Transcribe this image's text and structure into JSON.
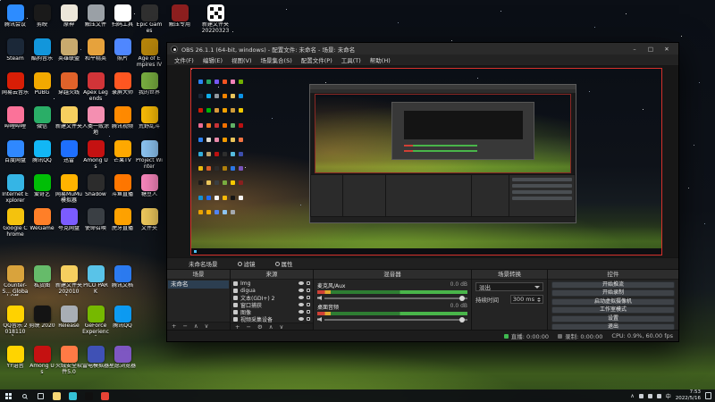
{
  "wallpaper": {
    "sky": "#0b0f16",
    "grass": "#41601f",
    "glow": "#de9239"
  },
  "desktop": {
    "main_icons": [
      {
        "label": "腾讯会议",
        "color": "#2d8cff"
      },
      {
        "label": "Steam",
        "color": "#1b2838"
      },
      {
        "label": "网易云音乐",
        "color": "#d81e06"
      },
      {
        "label": "哔哩哔哩",
        "color": "#fb7299"
      },
      {
        "label": "百度网盘",
        "color": "#2f88ff"
      },
      {
        "label": "Internet Explorer",
        "color": "#35b5e5"
      },
      {
        "label": "Google Chrome",
        "color": "#f4c20d"
      },
      {
        "label": "剪映",
        "color": "#1a1a1a"
      },
      {
        "label": "酷狗音乐",
        "color": "#1296db"
      },
      {
        "label": "PUBG",
        "color": "#f2a900"
      },
      {
        "label": "微信",
        "color": "#2aae67"
      },
      {
        "label": "腾讯QQ",
        "color": "#12b7f5"
      },
      {
        "label": "爱奇艺",
        "color": "#00be06"
      },
      {
        "label": "WeGame",
        "color": "#ff7f28"
      },
      {
        "label": "原神",
        "color": "#ece6d9"
      },
      {
        "label": "英雄联盟",
        "color": "#c8aa6e"
      },
      {
        "label": "穿越火线",
        "color": "#e0622a"
      },
      {
        "label": "新建文件夹",
        "color": "#f6cf5f"
      },
      {
        "label": "迅雷",
        "color": "#1e6fff"
      },
      {
        "label": "网易MuMu模拟器",
        "color": "#ffb300"
      },
      {
        "label": "夸克网盘",
        "color": "#7b5cff"
      },
      {
        "label": "解压文件",
        "color": "#9aa0a6"
      },
      {
        "label": "和平精英",
        "color": "#e6a23c"
      },
      {
        "label": "Apex Legends",
        "color": "#d13438"
      },
      {
        "label": "人类一败涂地",
        "color": "#f48fb1"
      },
      {
        "label": "Among Us",
        "color": "#c51111"
      },
      {
        "label": "Shadow",
        "color": "#2c2c2c"
      },
      {
        "label": "使命召唤",
        "color": "#3a3f44"
      },
      {
        "label": "扫码工具",
        "color": "#ffffff"
      },
      {
        "label": "照片",
        "color": "#4f87ff"
      },
      {
        "label": "录屏大师",
        "color": "#ff5722"
      },
      {
        "label": "腾讯视频",
        "color": "#ff8a00"
      },
      {
        "label": "芒果TV",
        "color": "#ffa900"
      },
      {
        "label": "斗鱼直播",
        "color": "#ff7700"
      },
      {
        "label": "虎牙直播",
        "color": "#ffa200"
      },
      {
        "label": "Epic Games",
        "color": "#2f2f2f"
      },
      {
        "label": "Age of Empires IV",
        "color": "#b8860b"
      },
      {
        "label": "我的世界",
        "color": "#7cb342"
      },
      {
        "label": "荒野乱斗",
        "color": "#ffc107"
      },
      {
        "label": "Project Winter",
        "color": "#90caf9"
      },
      {
        "label": "糖豆人",
        "color": "#ff8ac2"
      },
      {
        "label": "文件夹",
        "color": "#f6cf5f"
      }
    ],
    "bottom_icons": [
      {
        "label": "Counter-S... Global Off...",
        "color": "#d9a33c"
      },
      {
        "label": "私货图",
        "color": "#66bb6a"
      },
      {
        "label": "新建文件夹 2020101...",
        "color": "#f6cf5f"
      },
      {
        "label": "PICO PARK",
        "color": "#59c3e8"
      },
      {
        "label": "腾讯文档",
        "color": "#2c7bf0"
      },
      {
        "label": "QQ音乐 20181101...",
        "color": "#ffd200"
      },
      {
        "label": "剪映 2020",
        "color": "#141414"
      },
      {
        "label": "Release",
        "color": "#a8aeb5"
      },
      {
        "label": "GeForce Experience",
        "color": "#76b900"
      },
      {
        "label": "腾讯QQ",
        "color": "#0d9bf2"
      },
      {
        "label": "YY语音",
        "color": "#ffd400"
      },
      {
        "label": "Among Us",
        "color": "#c51111"
      },
      {
        "label": "火绒安全软件5.0",
        "color": "#ff7a45"
      },
      {
        "label": "雷电模拟器",
        "color": "#3f51b5"
      },
      {
        "label": "星愿浏览器",
        "color": "#7e57c2"
      }
    ],
    "top_icons": [
      {
        "label": "解压专用",
        "color": "#8d1f1f"
      },
      {
        "label": "新建文件夹 20220323",
        "color": "#ffffff",
        "qr": true
      }
    ]
  },
  "obs": {
    "title": "OBS 26.1.1 (64-bit, windows) - 配置文件: 未命名 - 场景: 未命名",
    "menu": [
      "文件(F)",
      "编辑(E)",
      "视图(V)",
      "场景集合(S)",
      "配置文件(P)",
      "工具(T)",
      "帮助(H)"
    ],
    "window_buttons": {
      "min": "–",
      "max": "□",
      "close": "✕"
    },
    "scene_row": {
      "label": "未命名场景",
      "filters": "滤镜",
      "properties": "属性"
    },
    "docks": {
      "scenes": {
        "title": "场景",
        "items": [
          "未命名"
        ],
        "toolbar": [
          "+",
          "−",
          "∧",
          "∨"
        ]
      },
      "sources": {
        "title": "来源",
        "items": [
          {
            "name": "Img"
          },
          {
            "name": "digua"
          },
          {
            "name": "文本(GDI+) 2"
          },
          {
            "name": "窗口捕获"
          },
          {
            "name": "图像"
          },
          {
            "name": "视频采集设备"
          }
        ],
        "toolbar": [
          "+",
          "−",
          "⚙",
          "∧",
          "∨"
        ]
      },
      "mixer": {
        "title": "混音器",
        "channels": [
          {
            "name": "麦克风/Aux",
            "db": "0.0 dB"
          },
          {
            "name": "桌面音频",
            "db": "0.0 dB"
          }
        ]
      },
      "transitions": {
        "title": "场景转换",
        "selected": "淡出",
        "duration_label": "持续时间",
        "duration": "300 ms"
      },
      "controls": {
        "title": "控件",
        "buttons": [
          "开始推流",
          "开始录制",
          "启动虚拟摄像机",
          "工作室模式",
          "设置",
          "退出"
        ]
      }
    },
    "statusbar": {
      "live": "直播: 0:00:00",
      "rec": "录制: 0:00:00",
      "cpu": "CPU: 0.9%, 60.00 fps"
    }
  },
  "taskbar": {
    "apps": [
      {
        "name": "file-explorer",
        "color": "#f8d775"
      },
      {
        "name": "edge",
        "color": "#35c1d6"
      },
      {
        "name": "obs-studio",
        "color": "#101010"
      },
      {
        "name": "chrome",
        "color": "#e84335"
      }
    ],
    "tray": {
      "chevron": "∧",
      "lang": "中",
      "time": "7:53",
      "date": "2022/5/16"
    }
  }
}
